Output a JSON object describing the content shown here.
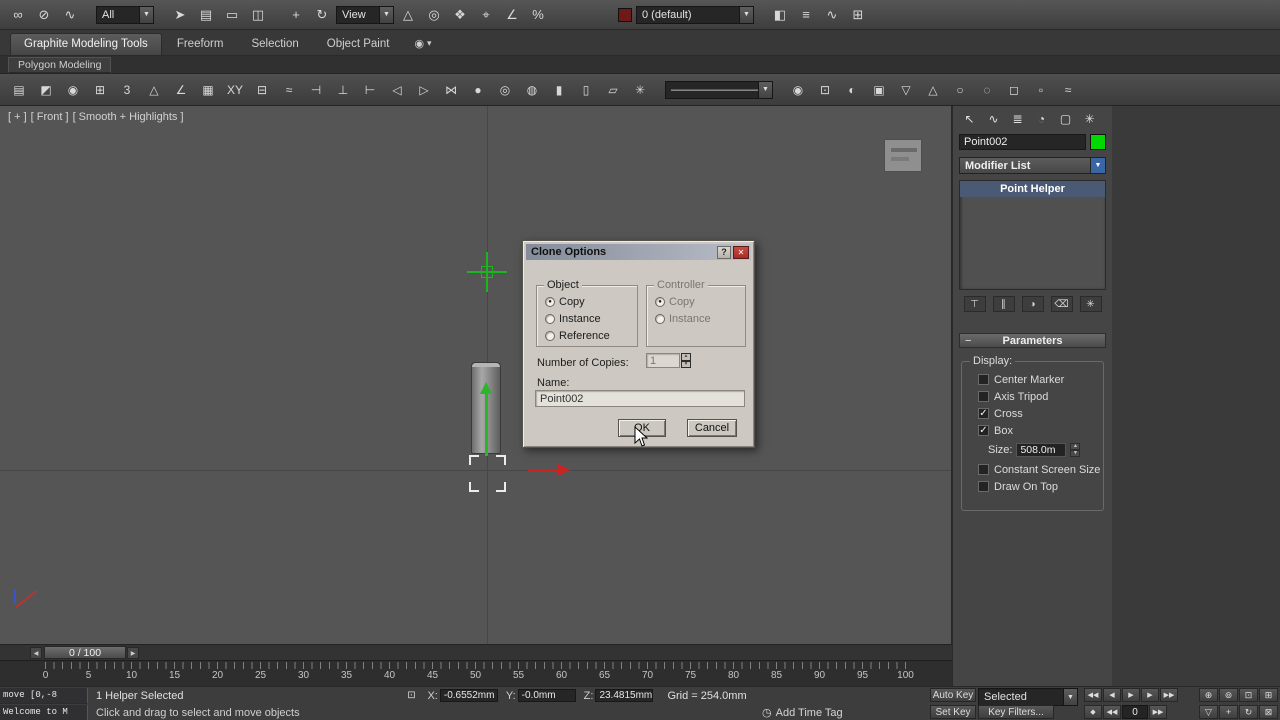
{
  "colors": {
    "viewport_bg": "#555555",
    "panel_bg": "#454545",
    "dialog_bg": "#cdc9c2",
    "dialog_close_red": "#a32e24",
    "helper_green": "#1db51d",
    "gizmo_green": "#2ab52a",
    "gizmo_red": "#cc2222",
    "object_color_swatch": "#00d800",
    "layer_swatch": "#6e1a1a",
    "stack_selected_bg": "#4a5a74"
  },
  "main_toolbar": {
    "icons_a": [
      {
        "name": "select-and-link",
        "glyph": "∞"
      },
      {
        "name": "unlink-selection",
        "glyph": "⊘"
      },
      {
        "name": "bind-to-space-warp",
        "glyph": "∿"
      }
    ],
    "selection_filter_value": "All",
    "icons_b": [
      {
        "name": "select-object",
        "glyph": "➤"
      },
      {
        "name": "select-by-name",
        "glyph": "▤"
      },
      {
        "name": "rectangular-selection-region",
        "glyph": "▭"
      },
      {
        "name": "window-crossing-toggle",
        "glyph": "◫"
      }
    ],
    "icons_c": [
      {
        "name": "select-and-move",
        "glyph": "+"
      },
      {
        "name": "select-and-rotate",
        "glyph": "↻"
      }
    ],
    "reference_coordinate_value": "View",
    "icons_d": [
      {
        "name": "select-and-scale",
        "glyph": "△"
      },
      {
        "name": "use-pivot-point-center",
        "glyph": "◎"
      },
      {
        "name": "select-and-manipulate",
        "glyph": "❖"
      },
      {
        "name": "snaps-toggle",
        "glyph": "⌖"
      },
      {
        "name": "angle-snap-toggle",
        "glyph": "∠"
      },
      {
        "name": "percent-snap-toggle",
        "glyph": "%"
      }
    ],
    "layer_value": "0 (default)",
    "icons_e": [
      {
        "name": "mirror",
        "glyph": "◧"
      },
      {
        "name": "align",
        "glyph": "≡"
      },
      {
        "name": "curve-editor",
        "glyph": "∿"
      },
      {
        "name": "schematic-view",
        "glyph": "⊞"
      }
    ]
  },
  "ribbon": {
    "tabs": [
      {
        "label": "Graphite Modeling Tools",
        "active": true
      },
      {
        "label": "Freeform",
        "active": false
      },
      {
        "label": "Selection",
        "active": false
      },
      {
        "label": "Object Paint",
        "active": false
      }
    ],
    "options_glyph": "◉",
    "options_arrow": "▾",
    "panel_tab": "Polygon Modeling"
  },
  "toolbar2": {
    "icons_left": [
      {
        "name": "modeling-mode",
        "glyph": "▤"
      },
      {
        "name": "show-end-result-toggle",
        "glyph": "◩"
      },
      {
        "name": "use-nurms",
        "glyph": "◉"
      },
      {
        "name": "swift-loop",
        "glyph": "⊞"
      },
      {
        "name": "generate-topology",
        "glyph": "3"
      },
      {
        "name": "symmetry-tool",
        "glyph": "△"
      },
      {
        "name": "angle-constraint",
        "glyph": "∠"
      },
      {
        "name": "make-planar",
        "glyph": "▦"
      },
      {
        "name": "xy-constraint",
        "glyph": "XY"
      },
      {
        "name": "grid-align",
        "glyph": "⊟"
      },
      {
        "name": "relax-tool",
        "glyph": "≈"
      },
      {
        "name": "align-left",
        "glyph": "⊣"
      },
      {
        "name": "align-bottom",
        "glyph": "⊥"
      },
      {
        "name": "align-right",
        "glyph": "⊢"
      },
      {
        "name": "loop-select",
        "glyph": "◁"
      },
      {
        "name": "ring-select",
        "glyph": "▷"
      },
      {
        "name": "distance-connect",
        "glyph": "⋈"
      },
      {
        "name": "sphere-primitive",
        "glyph": "●"
      },
      {
        "name": "torus-primitive",
        "glyph": "◎"
      },
      {
        "name": "teapot-primitive",
        "glyph": "◍"
      },
      {
        "name": "cylinder-primitive",
        "glyph": "▮"
      },
      {
        "name": "capsule-primitive",
        "glyph": "▯"
      },
      {
        "name": "plane-primitive",
        "glyph": "▱"
      },
      {
        "name": "autogrid-toggle",
        "glyph": "✳"
      }
    ],
    "preset_dropdown_value": "—————————",
    "icons_right": [
      {
        "name": "isolate-selection",
        "glyph": "◉"
      },
      {
        "name": "display-mask",
        "glyph": "⊡"
      },
      {
        "name": "soft-selection",
        "glyph": "◐"
      },
      {
        "name": "paint-deform",
        "glyph": "▣"
      },
      {
        "name": "shrink-selection",
        "glyph": "▽"
      },
      {
        "name": "grow-selection",
        "glyph": "△"
      },
      {
        "name": "edge-loop",
        "glyph": "○"
      },
      {
        "name": "edge-ring",
        "glyph": "◌"
      },
      {
        "name": "outline-faces",
        "glyph": "◻"
      },
      {
        "name": "inset-faces",
        "glyph": "▫"
      },
      {
        "name": "turbosmooth",
        "glyph": "≈"
      }
    ]
  },
  "viewport": {
    "menu_plus": "[ + ]",
    "menu_view": "[ Front ]",
    "menu_shading": "[ Smooth + Highlights ]"
  },
  "dialog": {
    "title": "Clone Options",
    "help_glyph": "?",
    "close_glyph": "✕",
    "object_group_label": "Object",
    "object_options": [
      {
        "label": "Copy",
        "dot": "●"
      },
      {
        "label": "Instance",
        "dot": ""
      },
      {
        "label": "Reference",
        "dot": ""
      }
    ],
    "controller_group_label": "Controller",
    "controller_options": [
      {
        "label": "Copy",
        "dot": "●"
      },
      {
        "label": "Instance",
        "dot": ""
      }
    ],
    "copies_label": "Number of Copies:",
    "copies_value": "1",
    "name_label": "Name:",
    "name_value": "Point002",
    "ok_label": "OK",
    "cancel_label": "Cancel"
  },
  "command_panel": {
    "tabs": [
      {
        "name": "create-tab",
        "glyph": "↖"
      },
      {
        "name": "modify-tab",
        "glyph": "∿"
      },
      {
        "name": "hierarchy-tab",
        "glyph": "≣"
      },
      {
        "name": "motion-tab",
        "glyph": "◔"
      },
      {
        "name": "display-tab",
        "glyph": "▢"
      },
      {
        "name": "utilities-tab",
        "glyph": "✳"
      }
    ],
    "object_name": "Point002",
    "modifier_list_label": "Modifier List",
    "stack_items": [
      {
        "label": "Point Helper",
        "selected": true
      }
    ],
    "stack_tools": [
      {
        "name": "pin-stack",
        "glyph": "⊤"
      },
      {
        "name": "show-end-result",
        "glyph": "∥"
      },
      {
        "name": "make-unique",
        "glyph": "◑"
      },
      {
        "name": "remove-modifier",
        "glyph": "⌫"
      },
      {
        "name": "configure-modifier-sets",
        "glyph": "✳"
      }
    ],
    "rollout_title": "Parameters",
    "rollout_collapse_glyph": "−",
    "display_group": {
      "label": "Display:",
      "checkboxes": [
        {
          "label": "Center Marker",
          "mark": ""
        },
        {
          "label": "Axis Tripod",
          "mark": ""
        },
        {
          "label": "Cross",
          "mark": "✓"
        },
        {
          "label": "Box",
          "mark": "✓"
        }
      ],
      "size_label": "Size:",
      "size_value": "508.0m",
      "extra_checkboxes": [
        {
          "label": "Constant Screen Size",
          "mark": ""
        },
        {
          "label": "Draw On Top",
          "mark": ""
        }
      ]
    }
  },
  "timeline": {
    "slider_value": "0 / 100",
    "prev_glyph": "◀",
    "next_glyph": "▶",
    "tick_labels": [
      "0",
      "5",
      "10",
      "15",
      "20",
      "25",
      "30",
      "35",
      "40",
      "45",
      "50",
      "55",
      "60",
      "65",
      "70",
      "75",
      "80",
      "85",
      "90",
      "95",
      "100"
    ]
  },
  "status_bar": {
    "macro_recorder_line": "move  [0,-8",
    "maxscript_line": "Welcome to M",
    "selection_line": "1 Helper Selected",
    "lock_glyph": "⊡",
    "coord_x_label": "X:",
    "coord_x_value": "-0.6552mm",
    "coord_y_label": "Y:",
    "coord_y_value": "-0.0mm",
    "coord_z_label": "Z:",
    "coord_z_value": "23.4815mm",
    "grid_text": "Grid = 254.0mm",
    "prompt_text": "Click and drag to select and move objects",
    "clock_glyph": "◷",
    "time_tag_text": "Add Time Tag",
    "auto_key_label": "Auto Key",
    "set_key_label": "Set Key",
    "selected_value": "Selected",
    "key_filters_label": "Key Filters...",
    "frame_field_value": "0",
    "transport_row1": [
      {
        "name": "go-to-start",
        "glyph": "◀◀"
      },
      {
        "name": "previous-frame",
        "glyph": "◀"
      },
      {
        "name": "play-animation",
        "glyph": "▶"
      },
      {
        "name": "next-frame",
        "glyph": "▶"
      },
      {
        "name": "go-to-end",
        "glyph": "▶▶"
      }
    ],
    "transport_row2_left": [
      {
        "name": "key-mode-toggle",
        "glyph": "◆"
      },
      {
        "name": "previous-key",
        "glyph": "◀◀"
      }
    ],
    "transport_row2_right": [
      {
        "name": "next-key",
        "glyph": "▶▶"
      }
    ],
    "nav_row1": [
      {
        "name": "zoom",
        "glyph": "⊕"
      },
      {
        "name": "zoom-all",
        "glyph": "⊚"
      },
      {
        "name": "zoom-extents",
        "glyph": "⊡"
      },
      {
        "name": "zoom-extents-all",
        "glyph": "⊞"
      }
    ],
    "nav_row2": [
      {
        "name": "field-of-view",
        "glyph": "▽"
      },
      {
        "name": "pan-view",
        "glyph": "+"
      },
      {
        "name": "orbit-viewport",
        "glyph": "↻"
      },
      {
        "name": "maximize-viewport-toggle",
        "glyph": "⊠"
      }
    ]
  }
}
